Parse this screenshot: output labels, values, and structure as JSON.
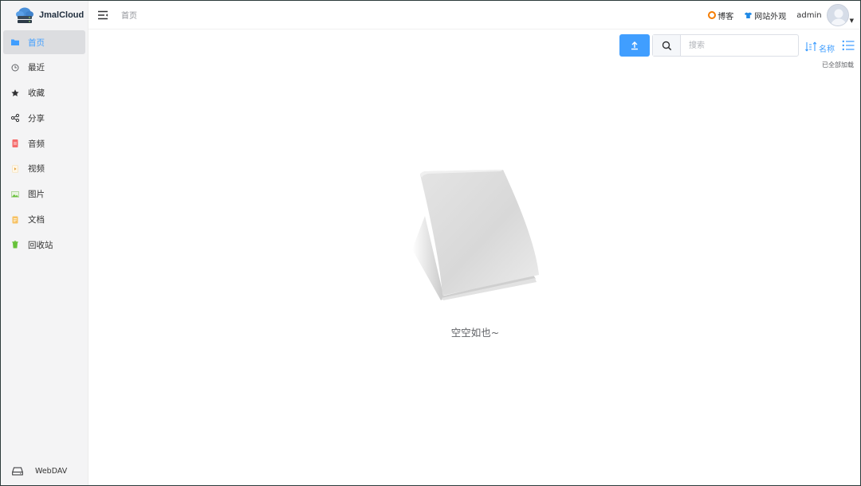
{
  "app": {
    "name": "JmalCloud"
  },
  "sidebar": {
    "items": [
      {
        "label": "首页",
        "icon": "folder-icon",
        "color": "#409eff",
        "active": true
      },
      {
        "label": "最近",
        "icon": "clock-icon",
        "color": "#606266"
      },
      {
        "label": "收藏",
        "icon": "star-icon",
        "color": "#303133"
      },
      {
        "label": "分享",
        "icon": "share-icon",
        "color": "#303133"
      },
      {
        "label": "音频",
        "icon": "audio-file-icon",
        "color": "#f56c6c"
      },
      {
        "label": "视频",
        "icon": "video-file-icon",
        "color": "#e6a23c"
      },
      {
        "label": "图片",
        "icon": "image-icon",
        "color": "#67c23a"
      },
      {
        "label": "文档",
        "icon": "document-icon",
        "color": "#f0b04f"
      },
      {
        "label": "回收站",
        "icon": "trash-icon",
        "color": "#67c23a"
      }
    ],
    "footer": {
      "label": "WebDAV",
      "icon": "drive-icon"
    }
  },
  "header": {
    "breadcrumb": "首页",
    "links": [
      {
        "label": "博客",
        "icon": "blog-icon",
        "color": "#f57c00"
      },
      {
        "label": "网站外观",
        "icon": "shirt-icon",
        "color": "#1e88e5"
      }
    ],
    "user": {
      "name": "admin"
    }
  },
  "toolbar": {
    "search_placeholder": "搜索",
    "sort_label": "名称",
    "load_status": "已全部加载",
    "accent": "#409eff"
  },
  "empty": {
    "text": "空空如也~"
  }
}
